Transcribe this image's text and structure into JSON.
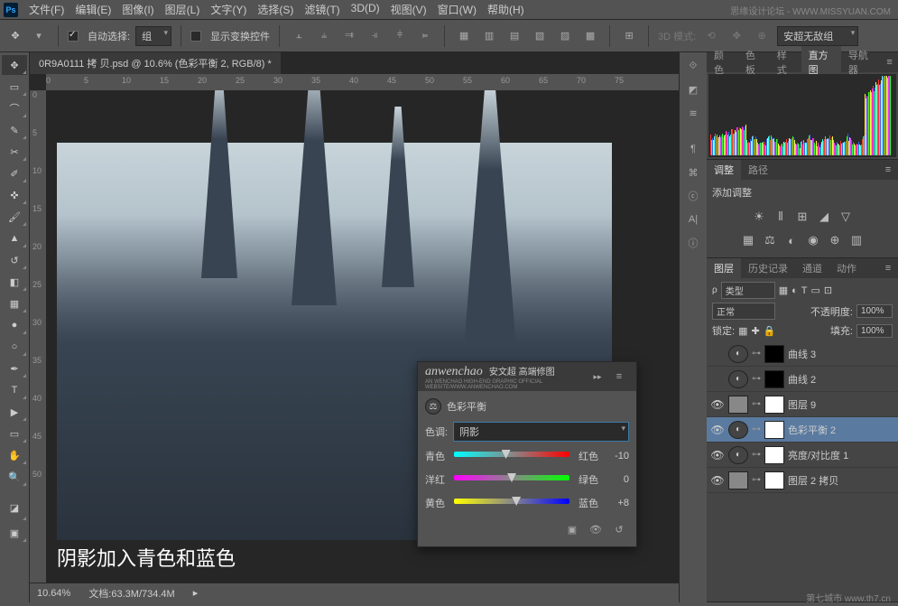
{
  "menu": {
    "items": [
      "文件(F)",
      "编辑(E)",
      "图像(I)",
      "图层(L)",
      "文字(Y)",
      "选择(S)",
      "滤镜(T)",
      "3D(D)",
      "视图(V)",
      "窗口(W)",
      "帮助(H)"
    ]
  },
  "watermark_top": "思缘设计论坛 - WWW.MISSYUAN.COM",
  "optbar": {
    "auto_select": "自动选择:",
    "group": "组",
    "show_transform": "显示变换控件",
    "mode3d": "3D 模式:",
    "preset": "安超无敌组"
  },
  "doc": {
    "tab": "0R9A0111 拷 贝.psd @ 10.6% (色彩平衡 2, RGB/8) *"
  },
  "ruler_h": [
    "0",
    "5",
    "10",
    "15",
    "20",
    "25",
    "30",
    "35",
    "40",
    "45",
    "50",
    "55",
    "60",
    "65",
    "70",
    "75"
  ],
  "ruler_v": [
    "0",
    "5",
    "10",
    "15",
    "20",
    "25",
    "30",
    "35",
    "40",
    "45",
    "50"
  ],
  "caption": "阴影加入青色和蓝色",
  "status": {
    "zoom": "10.64%",
    "doc": "文档:63.3M/734.4M"
  },
  "dialog": {
    "brand": "anwenchao",
    "brand_sub": "安文超 高端修图",
    "sub2": "AN WENCHAO HIGH-END GRAPHIC OFFICIAL WEBSITE/WWW.ANWENCHAO.COM",
    "title": "色彩平衡",
    "tone_label": "色调:",
    "tone_value": "阴影",
    "sliders": [
      {
        "left": "青色",
        "right": "红色",
        "val": "-10",
        "pos": 45
      },
      {
        "left": "洋红",
        "right": "绿色",
        "val": "0",
        "pos": 50
      },
      {
        "left": "黄色",
        "right": "蓝色",
        "val": "+8",
        "pos": 54
      }
    ]
  },
  "panels": {
    "color_tabs": [
      "颜色",
      "色板",
      "样式",
      "直方图",
      "导航器"
    ],
    "adjust_tabs": [
      "调整",
      "路径"
    ],
    "adjust_title": "添加调整",
    "layers_tabs": [
      "图层",
      "历史记录",
      "通道",
      "动作"
    ],
    "type_sel": "类型",
    "blend": "正常",
    "opacity_label": "不透明度:",
    "opacity": "100%",
    "lock_label": "锁定:",
    "fill_label": "填充:",
    "fill": "100%",
    "layers": [
      {
        "vis": false,
        "kind": "adj",
        "name": "曲线 3"
      },
      {
        "vis": false,
        "kind": "adj",
        "name": "曲线 2"
      },
      {
        "vis": true,
        "kind": "raster",
        "name": "图层 9"
      },
      {
        "vis": true,
        "kind": "adj",
        "name": "色彩平衡 2",
        "selected": true
      },
      {
        "vis": true,
        "kind": "adj",
        "name": "亮度/对比度 1"
      },
      {
        "vis": true,
        "kind": "raster",
        "name": "图层 2 拷贝"
      }
    ]
  },
  "footer_wm": "第七城市 www.th7.cn"
}
